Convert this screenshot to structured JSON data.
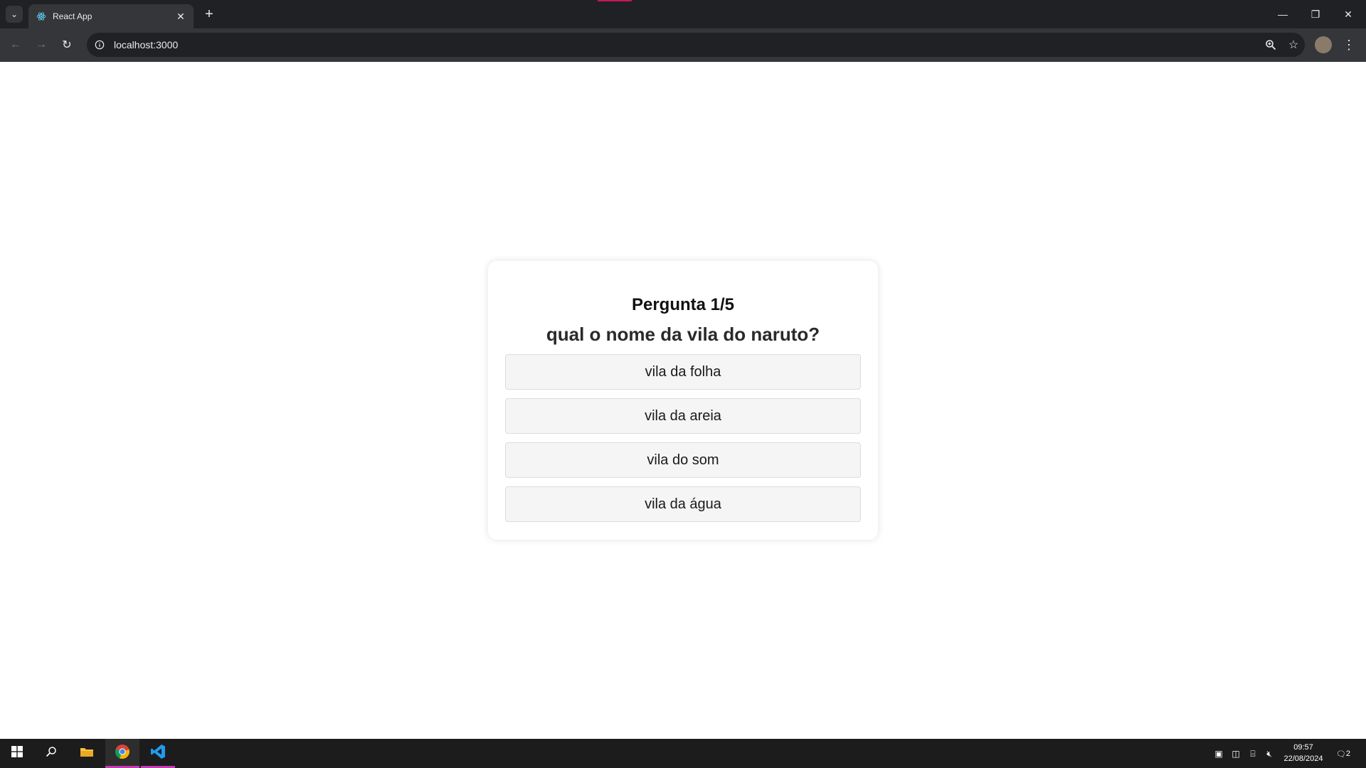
{
  "browser": {
    "tab": {
      "title": "React App",
      "favicon": "react-icon"
    },
    "url": "localhost:3000",
    "controls": {
      "minimize": "—",
      "maximize": "❐",
      "close": "✕"
    }
  },
  "quiz": {
    "counter": "Pergunta 1/5",
    "question": "qual o nome da vila do naruto?",
    "answers": [
      "vila da folha",
      "vila da areia",
      "vila do som",
      "vila da água"
    ]
  },
  "taskbar": {
    "time": "09:57",
    "date": "22/08/2024",
    "notification_count": "2",
    "active_accent": "#c23bb3"
  },
  "colors": {
    "tabbar_bg": "#202124",
    "toolbar_bg": "#35363a",
    "answer_bg": "#f5f5f5"
  }
}
